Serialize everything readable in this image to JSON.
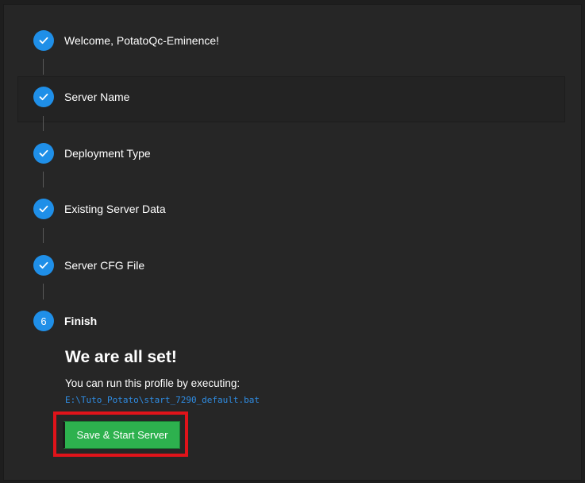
{
  "steps": [
    {
      "label": "Welcome, PotatoQc-Eminence!",
      "state": "done",
      "icon": "check-icon"
    },
    {
      "label": "Server Name",
      "state": "done",
      "icon": "check-icon"
    },
    {
      "label": "Deployment Type",
      "state": "done",
      "icon": "check-icon"
    },
    {
      "label": "Existing Server Data",
      "state": "done",
      "icon": "check-icon"
    },
    {
      "label": "Server CFG File",
      "state": "done",
      "icon": "check-icon"
    },
    {
      "label": "Finish",
      "state": "active",
      "number": "6"
    }
  ],
  "finish": {
    "title": "We are all set!",
    "description": "You can run this profile by executing:",
    "path": "E:\\Tuto_Potato\\start_7290_default.bat",
    "button_label": "Save & Start Server"
  },
  "colors": {
    "step_accent": "#1f8fe8",
    "button_green": "#2db14e",
    "path_blue": "#2f8de4",
    "annotation_red": "#e0131a",
    "background": "#262626"
  }
}
